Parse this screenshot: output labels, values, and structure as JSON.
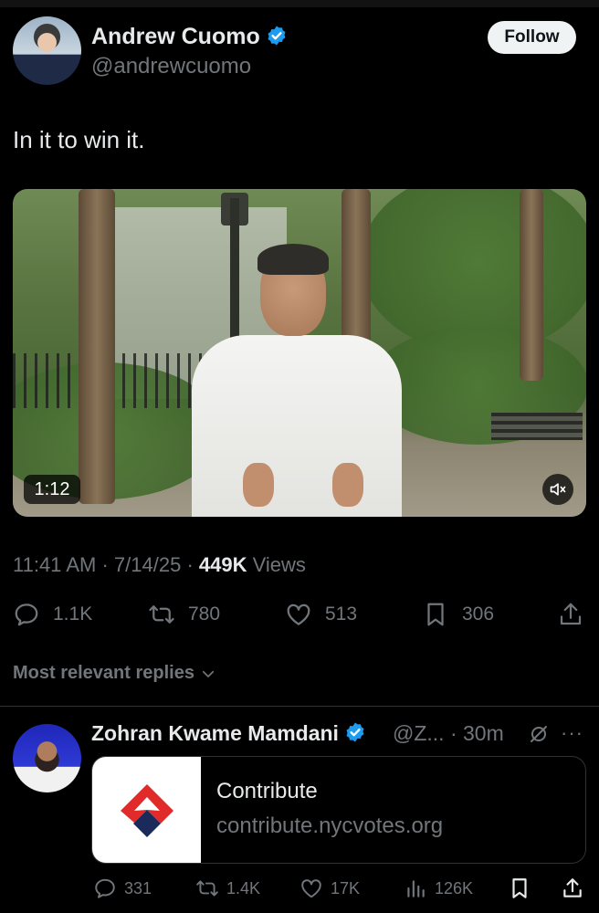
{
  "tweet": {
    "author_name": "Andrew Cuomo",
    "author_handle": "@andrewcuomo",
    "follow_label": "Follow",
    "text": "In it to win it.",
    "video_duration": "1:12",
    "time": "11:41 AM",
    "date": "7/14/25",
    "views_count": "449K",
    "views_label": "Views",
    "stats": {
      "replies": "1.1K",
      "reposts": "780",
      "likes": "513",
      "bookmarks": "306"
    }
  },
  "replies_filter": {
    "label": "Most relevant replies"
  },
  "reply": {
    "author_name": "Zohran Kwame Mamdani",
    "author_handle_time": "@Z... · 30m",
    "more": "···",
    "card_title": "Contribute",
    "card_domain": "contribute.nycvotes.org",
    "stats": {
      "replies": "331",
      "reposts": "1.4K",
      "likes": "17K",
      "views": "126K"
    }
  },
  "colors": {
    "background": "#000000",
    "text": "#e7e9ea",
    "secondary": "#71767b",
    "verified": "#1d9bf0",
    "divider": "#2f3336"
  }
}
